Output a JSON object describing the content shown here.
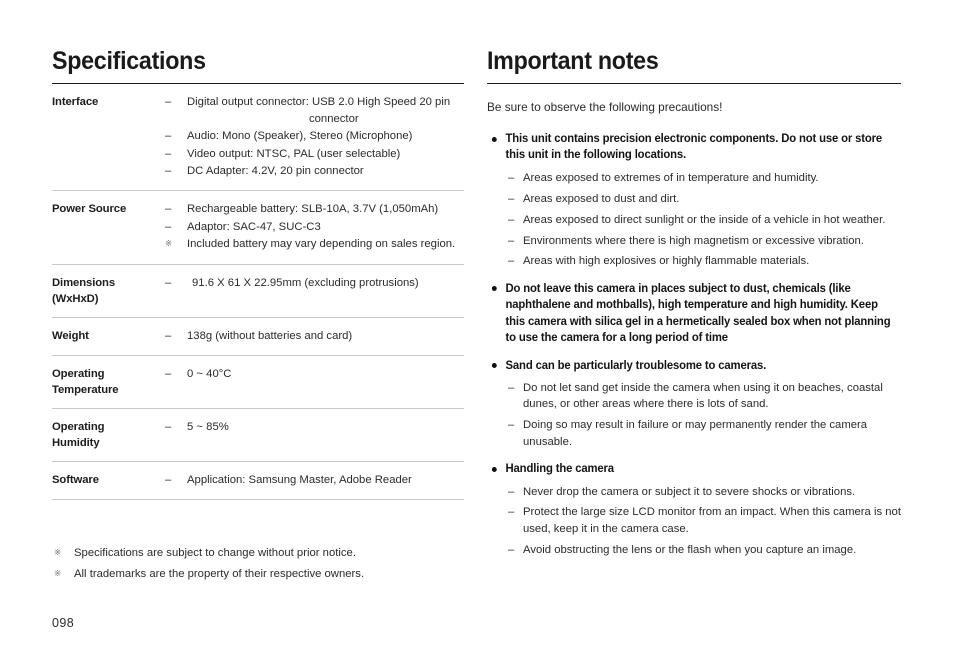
{
  "page": {
    "number": "098"
  },
  "specifications": {
    "title": "Specifications",
    "rows": [
      {
        "label": "Interface",
        "lines": [
          {
            "marker": "–",
            "text": "Digital output connector: USB 2.0 High Speed 20 pin",
            "continuation": "connector"
          },
          {
            "marker": "–",
            "text": "Audio: Mono (Speaker), Stereo (Microphone)"
          },
          {
            "marker": "–",
            "text": "Video output: NTSC, PAL (user selectable)"
          },
          {
            "marker": "–",
            "text": "DC Adapter: 4.2V, 20 pin connector"
          }
        ]
      },
      {
        "label": "Power Source",
        "lines": [
          {
            "marker": "–",
            "text": "Rechargeable battery: SLB-10A, 3.7V (1,050mAh)"
          },
          {
            "marker": "–",
            "text": "Adaptor: SAC-47, SUC-C3"
          },
          {
            "marker": "※",
            "text": "Included battery may vary depending on sales region."
          }
        ]
      },
      {
        "label": "Dimensions\n(WxHxD)",
        "label_line1": "Dimensions",
        "label_line2": "(WxHxD)",
        "lines": [
          {
            "marker": "–",
            "text": "91.6 X 61 X 22.95mm (excluding protrusions)",
            "extra_indent": true
          }
        ]
      },
      {
        "label": "Weight",
        "lines": [
          {
            "marker": "–",
            "text": "138g (without batteries and card)"
          }
        ]
      },
      {
        "label_line1": "Operating",
        "label_line2": "Temperature",
        "lines": [
          {
            "marker": "–",
            "text": "0 ~ 40°C"
          }
        ]
      },
      {
        "label_line1": "Operating",
        "label_line2": "Humidity",
        "lines": [
          {
            "marker": "–",
            "text": "5 ~ 85%"
          }
        ]
      },
      {
        "label": "Software",
        "lines": [
          {
            "marker": "–",
            "text": "Application: Samsung Master, Adobe Reader"
          }
        ]
      }
    ],
    "footnotes": [
      {
        "marker": "※",
        "text": "Specifications are subject to change without prior notice."
      },
      {
        "marker": "※",
        "text": "All trademarks are the property of their respective owners."
      }
    ]
  },
  "important_notes": {
    "title": "Important notes",
    "intro": "Be sure to observe the following precautions!",
    "groups": [
      {
        "heading": "This unit contains precision electronic components. Do not use or store this unit in the following locations.",
        "items": [
          "Areas exposed to extremes of in temperature and humidity.",
          "Areas exposed to dust and dirt.",
          "Areas exposed to direct sunlight or the inside of a vehicle in hot weather.",
          "Environments where there is high magnetism or excessive vibration.",
          "Areas with high explosives or highly flammable materials."
        ]
      },
      {
        "heading": "Do not leave this camera in places subject to dust, chemicals (like naphthalene and mothballs), high temperature and high humidity. Keep this camera with silica gel in a hermetically sealed box when not planning to use the camera for a long period of time",
        "items": []
      },
      {
        "heading": "Sand can be particularly troublesome to cameras.",
        "items": [
          "Do not let sand get inside the camera when using it on beaches, coastal dunes, or other areas where there is lots of sand.",
          "Doing so may result in failure or may permanently render the camera unusable."
        ]
      },
      {
        "heading": "Handling the camera",
        "items": [
          "Never drop the camera or subject it to severe shocks or vibrations.",
          "Protect the large size LCD monitor from an impact. When this camera is not used, keep it in the camera case.",
          "Avoid obstructing the lens or the flash when you capture an image."
        ]
      }
    ]
  },
  "colors": {
    "text": "#2b2b2b",
    "heading": "#1a1a1a",
    "rule": "#c9c9c9",
    "marker_muted": "#767676"
  }
}
